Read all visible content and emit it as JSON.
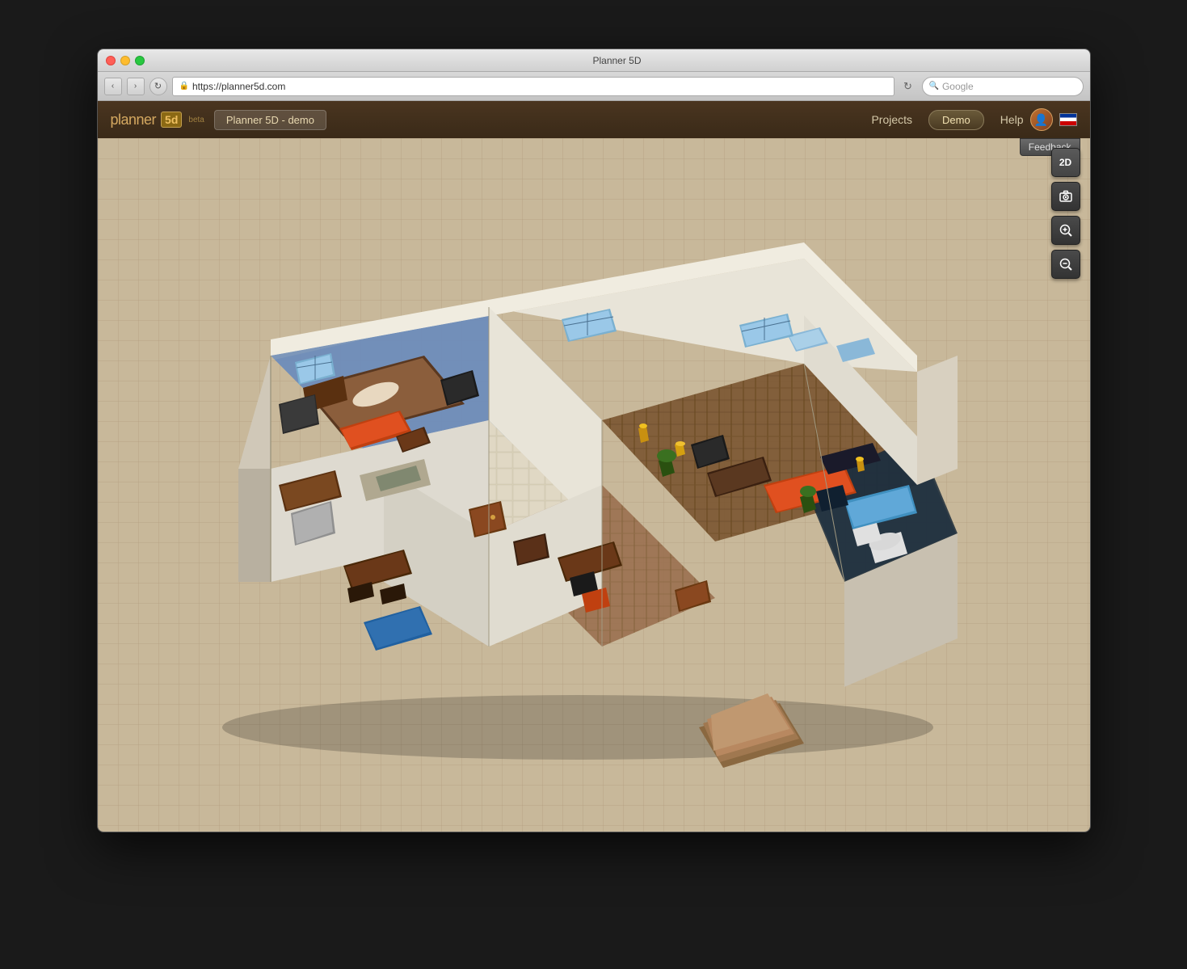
{
  "window": {
    "title": "Planner 5D",
    "url": "https://planner5d.com"
  },
  "navbar": {
    "logo_text": "planner",
    "logo_5d": "5d",
    "beta": "beta",
    "project_name": "Planner 5D - demo",
    "links": {
      "projects": "Projects",
      "demo": "Demo",
      "help": "Help"
    }
  },
  "toolbar": {
    "feedback": "Feedback",
    "view_2d": "2D",
    "camera_icon": "📷",
    "zoom_in_icon": "🔍+",
    "zoom_out_icon": "🔍-"
  },
  "browser": {
    "back": "‹",
    "forward": "›",
    "reload": "↻",
    "search_placeholder": "Google"
  }
}
